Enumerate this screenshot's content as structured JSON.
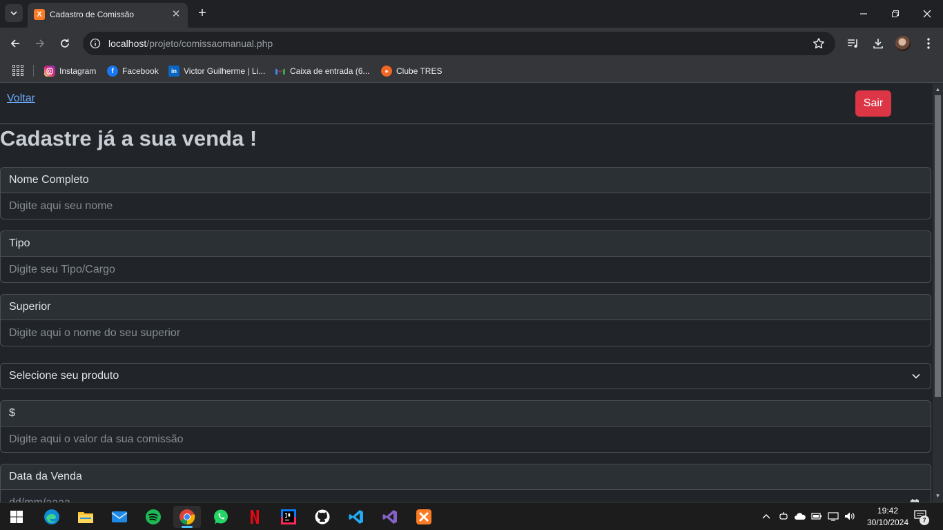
{
  "browser": {
    "tab_title": "Cadastro de Comissão",
    "tab_favicon_glyph": "X",
    "url_host": "localhost",
    "url_path": "/projeto/comissaomanual.php"
  },
  "bookmarks": [
    {
      "label": "Instagram",
      "icon": "instagram-icon",
      "color": "#e1306c"
    },
    {
      "label": "Facebook",
      "icon": "facebook-icon",
      "color": "#1877f2"
    },
    {
      "label": "Victor Guilherme | Li...",
      "icon": "linkedin-icon",
      "color": "#0a66c2"
    },
    {
      "label": "Caixa de entrada (6...",
      "icon": "gmail-icon",
      "color": "#ea4335"
    },
    {
      "label": "Clube TRES",
      "icon": "clube-tres-icon",
      "color": "#f26522"
    }
  ],
  "page": {
    "back_link": "Voltar",
    "logout_button": "Sair",
    "heading": "Cadastre já a sua venda !",
    "fields": {
      "nome": {
        "label": "Nome Completo",
        "placeholder": "Digite aqui seu nome"
      },
      "tipo": {
        "label": "Tipo",
        "placeholder": "Digite seu Tipo/Cargo"
      },
      "superior": {
        "label": "Superior",
        "placeholder": "Digite aqui o nome do seu superior"
      },
      "produto": {
        "selected": "Selecione seu produto"
      },
      "valor": {
        "label": "$",
        "placeholder": "Digite aqui o valor da sua comissão"
      },
      "data": {
        "label": "Data da Venda",
        "placeholder": "dd/mm/aaaa"
      }
    }
  },
  "taskbar": {
    "apps": [
      "windows-start-icon",
      "edge-icon",
      "file-explorer-icon",
      "mail-icon",
      "spotify-icon",
      "chrome-icon",
      "whatsapp-icon",
      "netflix-icon",
      "intellij-icon",
      "github-icon",
      "vscode-icon",
      "visual-studio-icon",
      "xampp-icon"
    ],
    "time": "19:42",
    "date": "30/10/2024",
    "notification_count": "7"
  },
  "colors": {
    "accent_danger": "#dc3545",
    "link": "#6ea8fe",
    "page_bg": "#212529"
  }
}
